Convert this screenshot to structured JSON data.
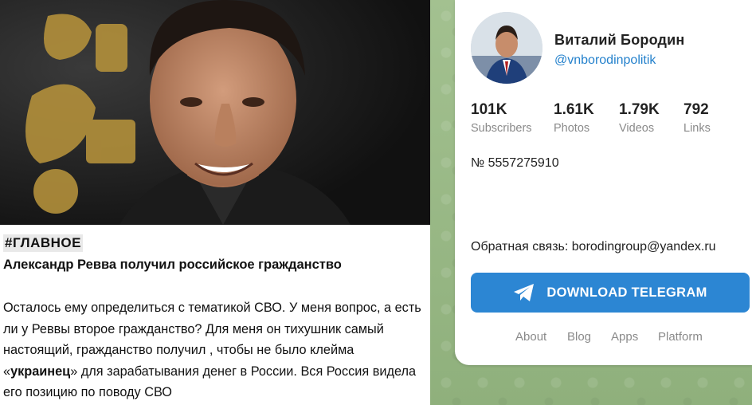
{
  "post": {
    "tag": "#ГЛАВНОЕ",
    "headline": "Александр Ревва получил российское гражданство",
    "body_before": "Осталось ему определиться с тематикой СВО. У меня вопрос, а есть ли у Реввы второе гражданство? Для меня он тихушник самый настоящий, гражданство получил , чтобы не было клейма «",
    "body_bold": "украинец",
    "body_after": "» для зарабатывания денег в России. Вся Россия видела его позицию по поводу СВО"
  },
  "profile": {
    "name": "Виталий Бородин",
    "handle": "@vnborodinpolitik",
    "stats": [
      {
        "value": "101K",
        "label": "Subscribers"
      },
      {
        "value": "1.61K",
        "label": "Photos"
      },
      {
        "value": "1.79K",
        "label": "Videos"
      },
      {
        "value": "792",
        "label": "Links"
      }
    ],
    "phone": "№ 5557275910",
    "contact": "Обратная связь: borodingroup@yandex.ru",
    "download_label": "DOWNLOAD TELEGRAM"
  },
  "footer": {
    "links": [
      "About",
      "Blog",
      "Apps",
      "Platform"
    ]
  },
  "colors": {
    "accent": "#2c86d3",
    "link": "#2481cc",
    "background": "#93b482"
  }
}
